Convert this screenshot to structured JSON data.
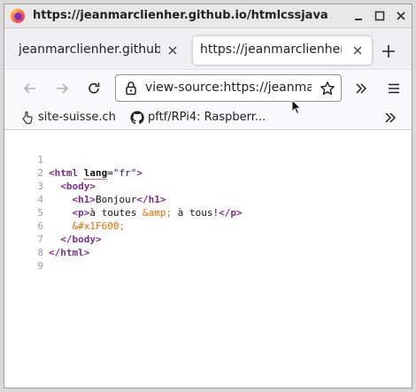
{
  "window": {
    "title": "https://jeanmarclienher.github.io/htmlcssjavasci"
  },
  "tabs": [
    {
      "label": "jeanmarclienher.github.io",
      "active": false
    },
    {
      "label": "https://jeanmarclienher.github.io",
      "active": true
    }
  ],
  "navbar": {
    "url": "view-source:https://jeanmarclienher.github.io"
  },
  "bookmarks": [
    {
      "label": "site-suisse.ch",
      "icon": "hand-icon"
    },
    {
      "label": "pftf/RPi4: Raspberr...",
      "icon": "github-icon"
    }
  ],
  "source": {
    "line_numbers": [
      "1",
      "2",
      "3",
      "4",
      "5",
      "6",
      "7",
      "8",
      "9"
    ],
    "html_tag": "html",
    "lang_attr": "lang",
    "lang_value": "\"fr\"",
    "body_tag": "body",
    "h1_tag": "h1",
    "h1_text": "Bonjour",
    "p_tag": "p",
    "p_text_before": "à toutes ",
    "p_entity": "&amp;",
    "p_text_after": " à tous!",
    "emoji_entity": "&#x1F600;"
  },
  "colors": {
    "tag": "#7d2d8a",
    "attr_value": "#1a1aa6",
    "entity": "#e46a00",
    "firefox_orange": "#ff7139",
    "firefox_purple": "#7b2fbe"
  }
}
